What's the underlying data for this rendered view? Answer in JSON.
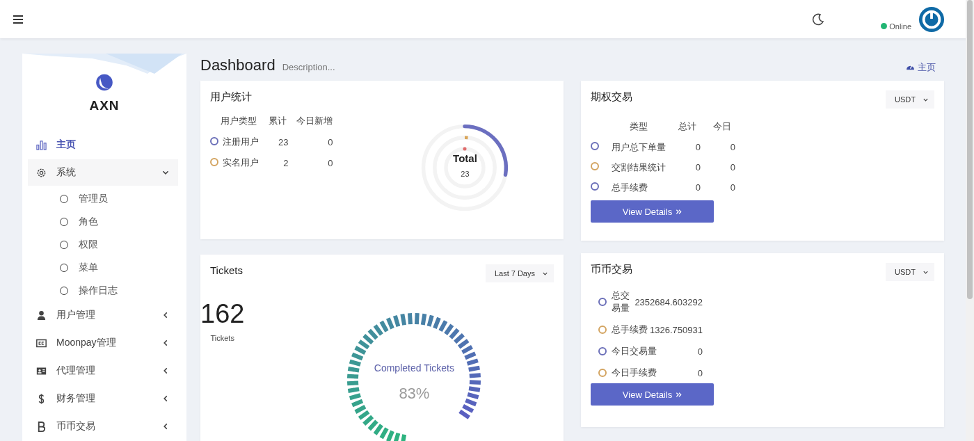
{
  "header": {
    "status": "Online",
    "online": true
  },
  "sidebar": {
    "brand": "AXN",
    "items": [
      {
        "label": "主页",
        "selected": true
      },
      {
        "label": "系统",
        "selected": false,
        "expanded": true,
        "children": [
          {
            "label": "管理员",
            "selected": false
          },
          {
            "label": "角色",
            "selected": false
          },
          {
            "label": "权限",
            "selected": false
          },
          {
            "label": "菜单",
            "selected": false
          },
          {
            "label": "操作日志",
            "selected": false
          }
        ]
      },
      {
        "label": "用户管理",
        "selected": false,
        "expanded": false
      },
      {
        "label": "Moonpay管理",
        "selected": false,
        "expanded": false
      },
      {
        "label": "代理管理",
        "selected": false,
        "expanded": false
      },
      {
        "label": "财务管理",
        "selected": false,
        "expanded": false
      },
      {
        "label": "币币交易",
        "selected": false,
        "expanded": false
      }
    ]
  },
  "page": {
    "title": "Dashboard",
    "description": "Description...",
    "breadcrumb": "主页"
  },
  "user_stats": {
    "title": "用户统计",
    "columns": [
      "用户类型",
      "累计",
      "今日新增"
    ],
    "rows": [
      {
        "label": "注册用户",
        "total": "23",
        "today": "0",
        "color": "#6b6fb8"
      },
      {
        "label": "实名用户",
        "total": "2",
        "today": "0",
        "color": "#d3a461"
      }
    ],
    "chart_title": "Total",
    "chart_value": "23"
  },
  "options": {
    "title": "期权交易",
    "currency": "USDT",
    "columns": [
      "类型",
      "总计",
      "今日"
    ],
    "rows": [
      {
        "label": "用户总下单量",
        "total": "0",
        "today": "0",
        "color": "#6b6fb8"
      },
      {
        "label": "交割结果统计",
        "total": "0",
        "today": "0",
        "color": "#d3a461"
      },
      {
        "label": "总手续费",
        "total": "0",
        "today": "0",
        "color": "#6b6fb8"
      }
    ],
    "button": "View Details"
  },
  "tickets": {
    "title": "Tickets",
    "period": "Last 7 Days",
    "count": "162",
    "count_label": "Tickets",
    "gauge_label": "Completed Tickets",
    "gauge_value": "83%"
  },
  "coin": {
    "title": "币币交易",
    "currency": "USDT",
    "rows": [
      {
        "label": "总交易量",
        "value": "2352684.603292",
        "color": "#6b6fb8"
      },
      {
        "label": "总手续费",
        "value": "1326.750931",
        "color": "#d3a461"
      },
      {
        "label": "今日交易量",
        "value": "0",
        "color": "#6b6fb8"
      },
      {
        "label": "今日手续费",
        "value": "0",
        "color": "#d3a461"
      }
    ],
    "button": "View Details"
  }
}
